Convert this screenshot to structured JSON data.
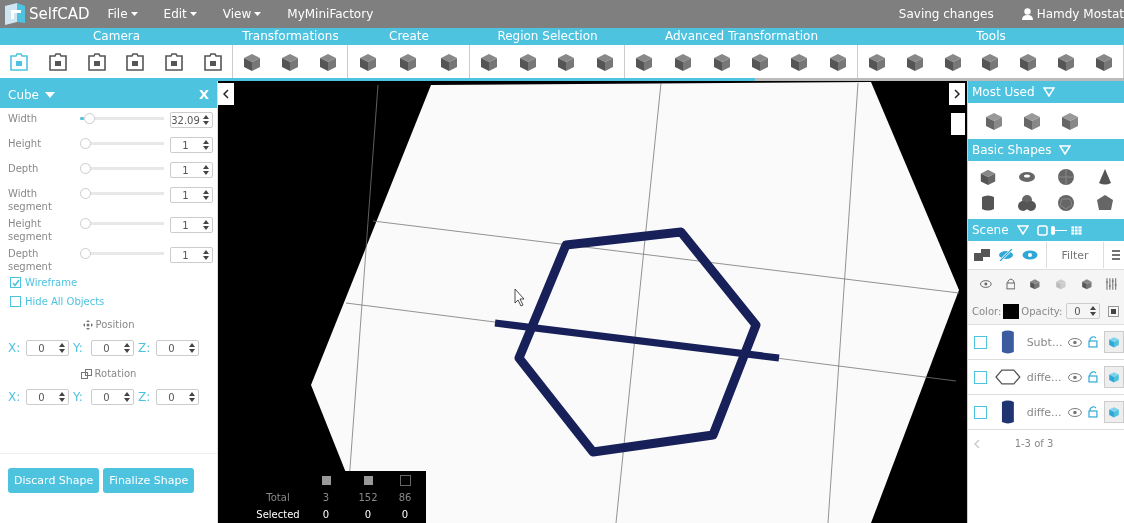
{
  "topbar": {
    "logo": "SelfCAD",
    "menus": [
      "File",
      "Edit",
      "View"
    ],
    "link": "MyMiniFactory",
    "status": "Saving changes",
    "user": "Hamdy Mostat"
  },
  "toolbar": {
    "groups": [
      {
        "label": "Camera"
      },
      {
        "label": "Transformations"
      },
      {
        "label": "Create"
      },
      {
        "label": "Region Selection"
      },
      {
        "label": "Advanced Transformation"
      },
      {
        "label": "Tools"
      }
    ],
    "progress": {
      "level": 0.672
    }
  },
  "left_panel": {
    "title": "Cube",
    "close": "X",
    "params": [
      {
        "label": "Width",
        "value": "32.09",
        "level": 0.05
      },
      {
        "label": "Height",
        "value": "1",
        "level": 0
      },
      {
        "label": "Depth",
        "value": "1",
        "level": 0
      },
      {
        "label": "Width segment",
        "value": "1",
        "level": 0
      },
      {
        "label": "Height segment",
        "value": "1",
        "level": 0
      },
      {
        "label": "Depth segment",
        "value": "1",
        "level": 0
      }
    ],
    "options": [
      {
        "label": "Wireframe",
        "checked": true
      },
      {
        "label": "Hide All Objects",
        "checked": false
      }
    ],
    "sections": [
      {
        "title": "Position",
        "fields": [
          {
            "axis": "X:",
            "value": "0"
          },
          {
            "axis": "Y:",
            "value": "0"
          },
          {
            "axis": "Z:",
            "value": "0"
          }
        ]
      },
      {
        "title": "Rotation",
        "fields": [
          {
            "axis": "X:",
            "value": "0"
          },
          {
            "axis": "Y:",
            "value": "0"
          },
          {
            "axis": "Z:",
            "value": "0"
          }
        ]
      }
    ],
    "buttons": [
      "Discard Shape",
      "Finalize Shape"
    ]
  },
  "viewport": {
    "stats": {
      "rows": [
        {
          "label": "Total",
          "values": [
            "3",
            "152",
            "86"
          ]
        },
        {
          "label": "Selected",
          "values": [
            "0",
            "0",
            "0"
          ]
        }
      ]
    }
  },
  "right_panel": {
    "most_used": {
      "title": "Most Used"
    },
    "basic_shapes": {
      "title": "Basic Shapes"
    },
    "scene": {
      "title": "Scene",
      "filter_placeholder": "Filter",
      "color_label": "Color:",
      "opacity_label": "Opacity:",
      "opacity": "0",
      "objects": [
        {
          "name": "Subt...",
          "kind": "cylinder",
          "checked": false
        },
        {
          "name": "diffe...",
          "kind": "hexagon",
          "checked": false
        },
        {
          "name": "diffe...",
          "kind": "cylinder-dark",
          "checked": false
        }
      ],
      "pagination": "1-3 of 3"
    }
  }
}
